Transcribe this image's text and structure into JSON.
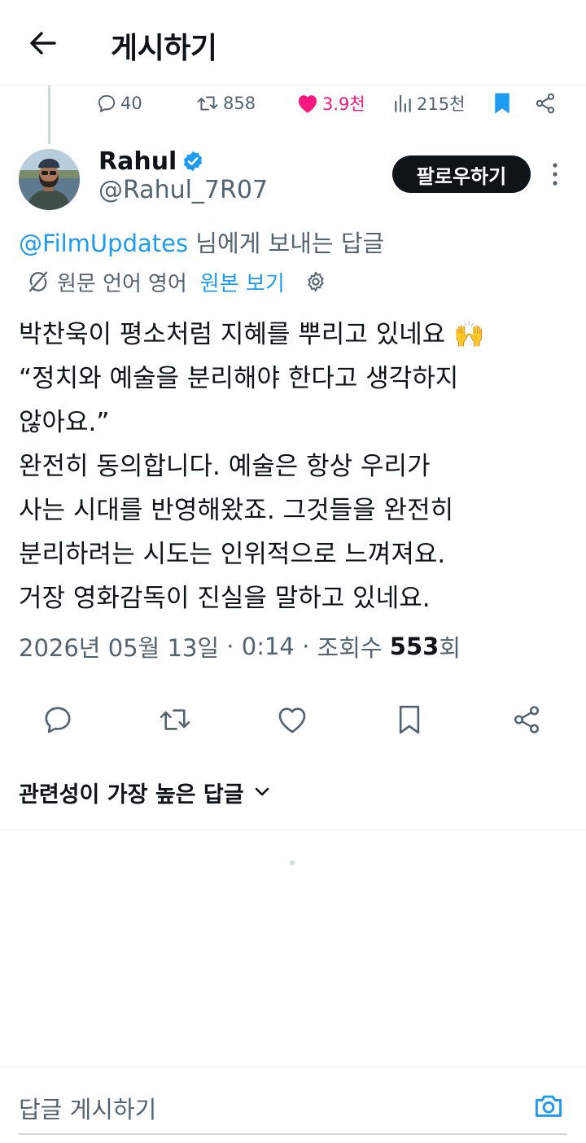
{
  "header": {
    "title": "게시하기"
  },
  "parent_stats": {
    "replies": "40",
    "reposts": "858",
    "likes": "3.9천",
    "views": "215천"
  },
  "author": {
    "display_name": "Rahul",
    "handle": "@Rahul_7R07"
  },
  "follow_label": "팔로우하기",
  "reply_context": {
    "mention": "@FilmUpdates",
    "suffix": " 님에게 보내는 답글"
  },
  "translation": {
    "label": "원문 언어",
    "language": "영어",
    "show_original": "원본 보기"
  },
  "tweet": {
    "lines": [
      "박찬욱이 평소처럼 지혜를 뿌리고 있네요 🙌",
      "“정치와 예술을 분리해야 한다고 생각하지",
      "않아요.”",
      "완전히 동의합니다. 예술은 항상 우리가",
      "사는 시대를 반영해왔죠. 그것들을 완전히",
      "분리하려는 시도는 인위적으로 느껴져요.",
      "거장 영화감독이 진실을 말하고 있네요."
    ],
    "date": "2026년 05월 13일",
    "time": "0:14",
    "views_label": "조회수",
    "views_count": "553",
    "views_unit": "회"
  },
  "sort": {
    "label": "관련성이 가장 높은 답글"
  },
  "composer": {
    "placeholder": "답글 게시하기"
  },
  "colors": {
    "accent": "#1d9bf0",
    "like": "#f91880",
    "text": "#0f1419",
    "muted": "#536471"
  },
  "icons": [
    "back-arrow-icon",
    "reply-icon",
    "repost-icon",
    "heart-icon",
    "views-icon",
    "bookmark-icon",
    "share-icon",
    "verified-badge-icon",
    "more-icon",
    "translate-icon",
    "gear-icon",
    "chevron-down-icon",
    "camera-icon"
  ]
}
